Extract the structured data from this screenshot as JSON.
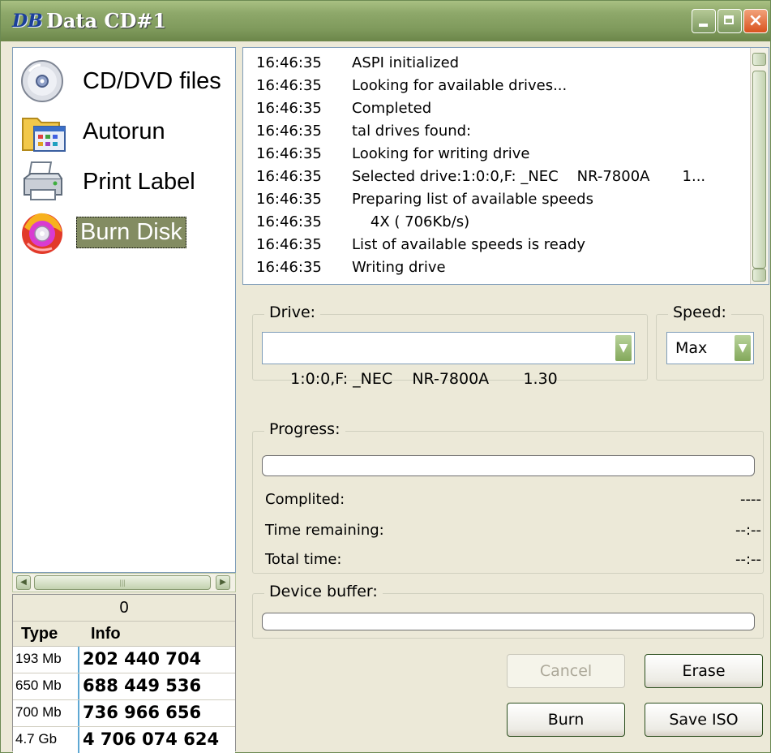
{
  "window": {
    "logo": "DB",
    "title": "Data CD#1"
  },
  "nav": {
    "items": [
      {
        "label": "CD/DVD files",
        "icon": "cd-dvd-icon"
      },
      {
        "label": "Autorun",
        "icon": "autorun-folder-icon"
      },
      {
        "label": "Print Label",
        "icon": "printer-icon"
      },
      {
        "label": "Burn Disk",
        "icon": "burn-disc-icon",
        "selected": true
      }
    ]
  },
  "info": {
    "count": "0",
    "headers": {
      "type": "Type",
      "info": "Info"
    },
    "rows": [
      {
        "type": "193 Mb",
        "info": "202 440 704"
      },
      {
        "type": "650 Mb",
        "info": "688 449 536"
      },
      {
        "type": "700 Mb",
        "info": "736 966 656"
      },
      {
        "type": "4.7 Gb",
        "info": "4 706 074 624"
      }
    ]
  },
  "log": [
    {
      "time": "16:46:35",
      "msg": "ASPI initialized"
    },
    {
      "time": "16:46:35",
      "msg": "Looking for available drives..."
    },
    {
      "time": "16:46:35",
      "msg": "Completed"
    },
    {
      "time": "16:46:35",
      "msg": "tal drives found:"
    },
    {
      "time": "16:46:35",
      "msg": "Looking for writing drive"
    },
    {
      "time": "16:46:35",
      "msg": "Selected drive:1:0:0,F: _NEC    NR-7800A       1..."
    },
    {
      "time": "16:46:35",
      "msg": "Preparing list of available speeds"
    },
    {
      "time": "16:46:35",
      "msg": "    4X ( 706Kb/s)"
    },
    {
      "time": "16:46:35",
      "msg": "List of available speeds is ready"
    },
    {
      "time": "16:46:35",
      "msg": "Writing drive"
    }
  ],
  "drive": {
    "label": "Drive:",
    "value": "1:0:0,F: _NEC    NR-7800A       1.30"
  },
  "speed": {
    "label": "Speed:",
    "value": "Max"
  },
  "progress": {
    "label": "Progress:",
    "value": 0,
    "stats": [
      {
        "label": "Complited:",
        "value": "----"
      },
      {
        "label": "Time remaining:",
        "value": "--:--"
      },
      {
        "label": "Total time:",
        "value": "--:--"
      }
    ]
  },
  "buffer": {
    "label": "Device buffer:",
    "value": 0
  },
  "buttons": {
    "cancel": "Cancel",
    "erase": "Erase",
    "burn": "Burn",
    "save_iso": "Save ISO"
  },
  "colors": {
    "title_bar": "#8ea86a",
    "selected_item": "#838c62",
    "close_button": "#d9531e"
  }
}
